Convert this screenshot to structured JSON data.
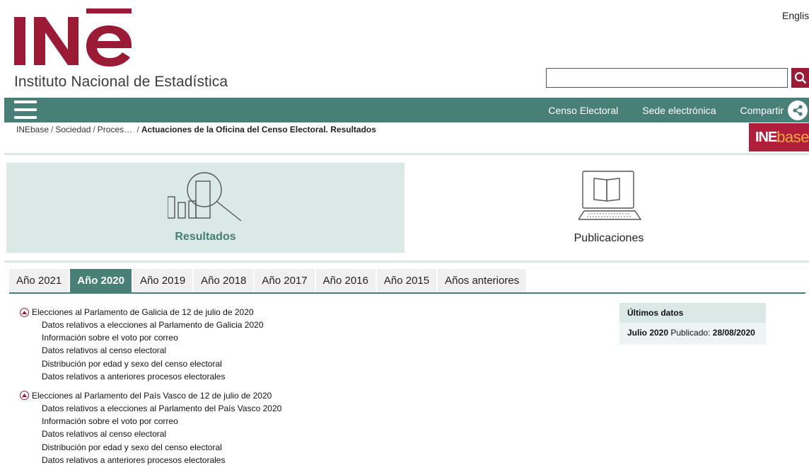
{
  "header": {
    "logo_text": "INE",
    "subtitle": "Instituto Nacional de Estadística",
    "language_link": "English",
    "search_placeholder": "",
    "search_icon": "search-icon"
  },
  "nav": {
    "menu_icon": "hamburger-menu-icon",
    "links": [
      "Censo Electoral",
      "Sede electrónica",
      "Compartir"
    ],
    "share_icon": "share-icon"
  },
  "breadcrumb": {
    "items": [
      "INEbase",
      "Sociedad",
      "Proces…"
    ],
    "current": "Actuaciones de la Oficina del Censo Electoral. Resultados"
  },
  "inebase_logo": {
    "part1": "INE",
    "part2": "base"
  },
  "cards": {
    "resultados": {
      "label": "Resultados",
      "icon": "chart-magnifier-icon"
    },
    "publicaciones": {
      "label": "Publicaciones",
      "icon": "book-laptop-icon"
    }
  },
  "tabs": [
    {
      "label": "Año 2021",
      "active": false
    },
    {
      "label": "Año 2020",
      "active": true
    },
    {
      "label": "Año 2019",
      "active": false
    },
    {
      "label": "Año 2018",
      "active": false
    },
    {
      "label": "Año 2017",
      "active": false
    },
    {
      "label": "Año 2016",
      "active": false
    },
    {
      "label": "Año 2015",
      "active": false
    },
    {
      "label": "Años anteriores",
      "active": false
    }
  ],
  "sections": [
    {
      "title": "Elecciones al Parlamento de Galicia de 12 de julio de 2020",
      "items": [
        "Datos relativos a elecciones al Parlamento de Galicia 2020",
        "Información sobre el voto por correo",
        "Datos relativos al censo electoral",
        "Distribución por edad y sexo del censo electoral",
        "Datos relativos a anteriores procesos electorales"
      ]
    },
    {
      "title": "Elecciones al Parlamento del País Vasco de 12 de julio de 2020",
      "items": [
        "Datos relativos a elecciones al Parlamento del País Vasco 2020",
        "Información sobre el voto por correo",
        "Datos relativos al censo electoral",
        "Distribución por edad y sexo del censo electoral",
        "Datos relativos a anteriores procesos electorales"
      ]
    }
  ],
  "ultimos_datos": {
    "title": "Últimos datos",
    "period": "Julio 2020",
    "published_label": "Publicado:",
    "published_date": "28/08/2020"
  },
  "colors": {
    "brand_red": "#9b1b36",
    "nav_green": "#487f77",
    "card_bg": "#dbe9e6"
  }
}
